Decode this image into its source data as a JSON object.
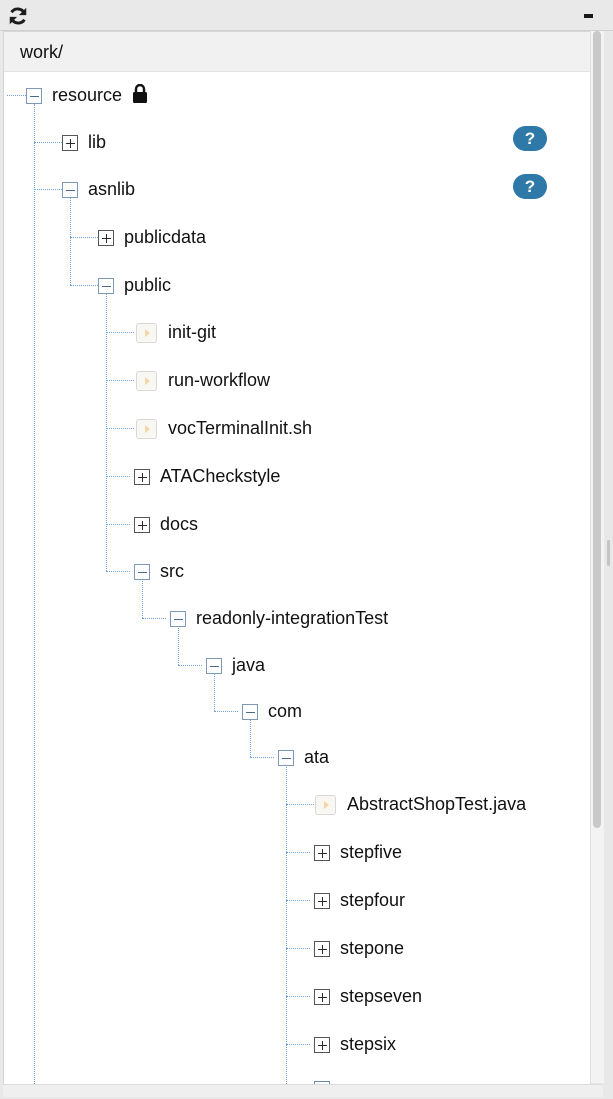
{
  "toolbar": {
    "refresh_icon": "refresh-icon",
    "minimize_icon": "minimize-icon"
  },
  "path": "work/",
  "help_label": "?",
  "tree": [
    {
      "label": "resource",
      "kind": "folder",
      "state": "expanded",
      "locked": true
    },
    {
      "label": "lib",
      "kind": "folder",
      "state": "collapsed",
      "help": true
    },
    {
      "label": "asnlib",
      "kind": "folder",
      "state": "expanded",
      "help": true
    },
    {
      "label": "publicdata",
      "kind": "folder",
      "state": "collapsed"
    },
    {
      "label": "public",
      "kind": "folder",
      "state": "expanded"
    },
    {
      "label": "init-git",
      "kind": "file"
    },
    {
      "label": "run-workflow",
      "kind": "file"
    },
    {
      "label": "vocTerminalInit.sh",
      "kind": "file"
    },
    {
      "label": "ATACheckstyle",
      "kind": "folder",
      "state": "collapsed"
    },
    {
      "label": "docs",
      "kind": "folder",
      "state": "collapsed"
    },
    {
      "label": "src",
      "kind": "folder",
      "state": "expanded"
    },
    {
      "label": "readonly-integrationTest",
      "kind": "folder",
      "state": "expanded"
    },
    {
      "label": "java",
      "kind": "folder",
      "state": "expanded"
    },
    {
      "label": "com",
      "kind": "folder",
      "state": "expanded"
    },
    {
      "label": "ata",
      "kind": "folder",
      "state": "expanded"
    },
    {
      "label": "AbstractShopTest.java",
      "kind": "file"
    },
    {
      "label": "stepfive",
      "kind": "folder",
      "state": "collapsed"
    },
    {
      "label": "stepfour",
      "kind": "folder",
      "state": "collapsed"
    },
    {
      "label": "stepone",
      "kind": "folder",
      "state": "collapsed"
    },
    {
      "label": "stepseven",
      "kind": "folder",
      "state": "collapsed"
    },
    {
      "label": "stepsix",
      "kind": "folder",
      "state": "collapsed"
    }
  ]
}
